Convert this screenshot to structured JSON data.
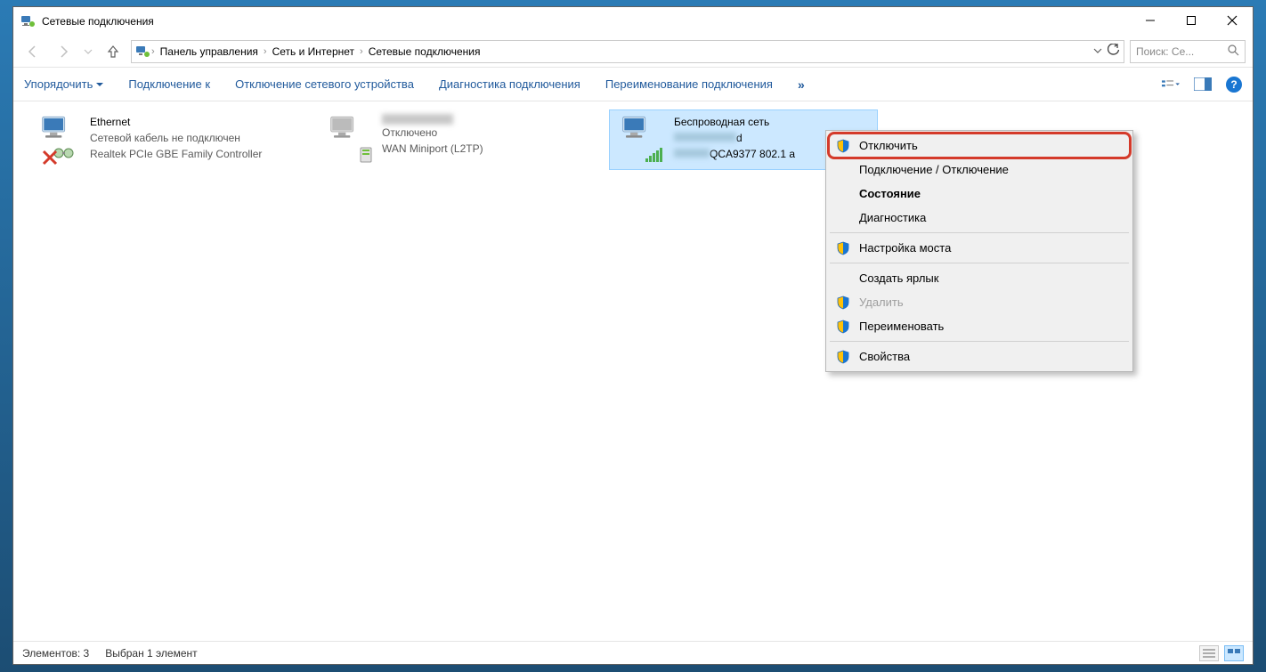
{
  "window": {
    "title": "Сетевые подключения"
  },
  "breadcrumb": {
    "items": [
      "Панель управления",
      "Сеть и Интернет",
      "Сетевые подключения"
    ]
  },
  "search": {
    "placeholder": "Поиск: Се..."
  },
  "toolbar": {
    "items": [
      "Упорядочить",
      "Подключение к",
      "Отключение сетевого устройства",
      "Диагностика подключения",
      "Переименование подключения"
    ],
    "overflow": "»"
  },
  "connections": [
    {
      "name": "Ethernet",
      "status": "Сетевой кабель не подключен",
      "hw": "Realtek PCIe GBE Family Controller",
      "state": "disconnected"
    },
    {
      "name": "",
      "status": "Отключено",
      "hw": "WAN Miniport (L2TP)",
      "state": "disabled"
    },
    {
      "name": "Беспроводная сеть",
      "status": "d",
      "hw": "QCA9377 802.1  a",
      "state": "connected",
      "selected": true
    }
  ],
  "context_menu": {
    "items": [
      {
        "label": "Отключить",
        "shield": true,
        "highlight": true
      },
      {
        "label": "Подключение / Отключение"
      },
      {
        "label": "Состояние",
        "bold": true
      },
      {
        "label": "Диагностика"
      },
      {
        "sep": true
      },
      {
        "label": "Настройка моста",
        "shield": true
      },
      {
        "sep": true
      },
      {
        "label": "Создать ярлык"
      },
      {
        "label": "Удалить",
        "shield": true,
        "disabled": true
      },
      {
        "label": "Переименовать",
        "shield": true
      },
      {
        "sep": true
      },
      {
        "label": "Свойства",
        "shield": true
      }
    ]
  },
  "statusbar": {
    "count_label": "Элементов: 3",
    "selection_label": "Выбран 1 элемент"
  }
}
